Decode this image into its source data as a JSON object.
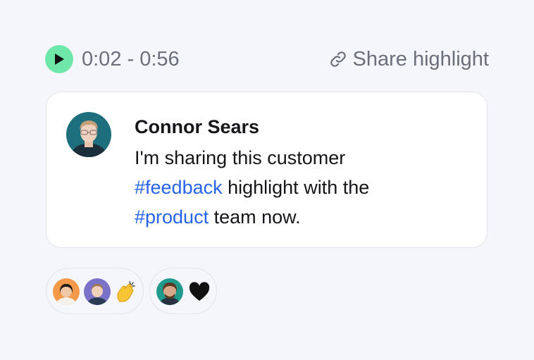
{
  "player": {
    "time_range": "0:02 - 0:56",
    "share_label": "Share highlight"
  },
  "comment": {
    "author": "Connor Sears",
    "line1": "I'm sharing this customer",
    "hashtag1": "#feedback",
    "line2_rest": " highlight with the",
    "hashtag2": "#product",
    "line3_rest": " team now."
  },
  "reactions": [
    {
      "emoji": "clapping-hands-icon",
      "users": 2
    },
    {
      "emoji": "heart-icon",
      "users": 1
    }
  ],
  "colors": {
    "background": "#f5f6fb",
    "play_button": "#6ee7a8",
    "hashtag": "#2563eb",
    "muted_text": "#6b6f7b"
  }
}
